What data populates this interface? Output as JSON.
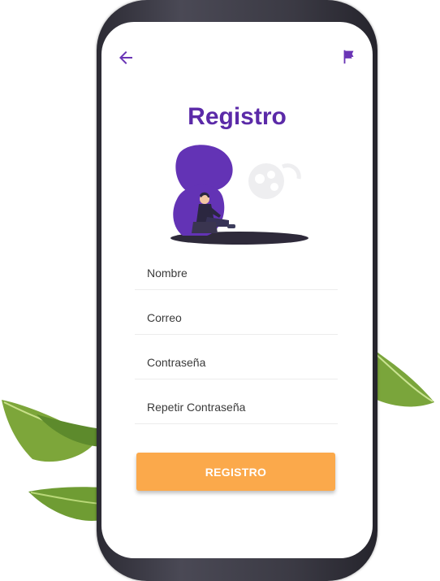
{
  "screen": {
    "title": "Registro"
  },
  "icons": {
    "back": "arrow-left-icon",
    "flag": "flag-icon"
  },
  "form": {
    "fields": [
      {
        "placeholder": "Nombre"
      },
      {
        "placeholder": "Correo"
      },
      {
        "placeholder": "Contraseña"
      },
      {
        "placeholder": "Repetir Contraseña"
      }
    ],
    "submit_label": "REGISTRO"
  },
  "colors": {
    "accent": "#5b2aa8",
    "button": "#fba94b",
    "icon": "#6a35b5"
  }
}
